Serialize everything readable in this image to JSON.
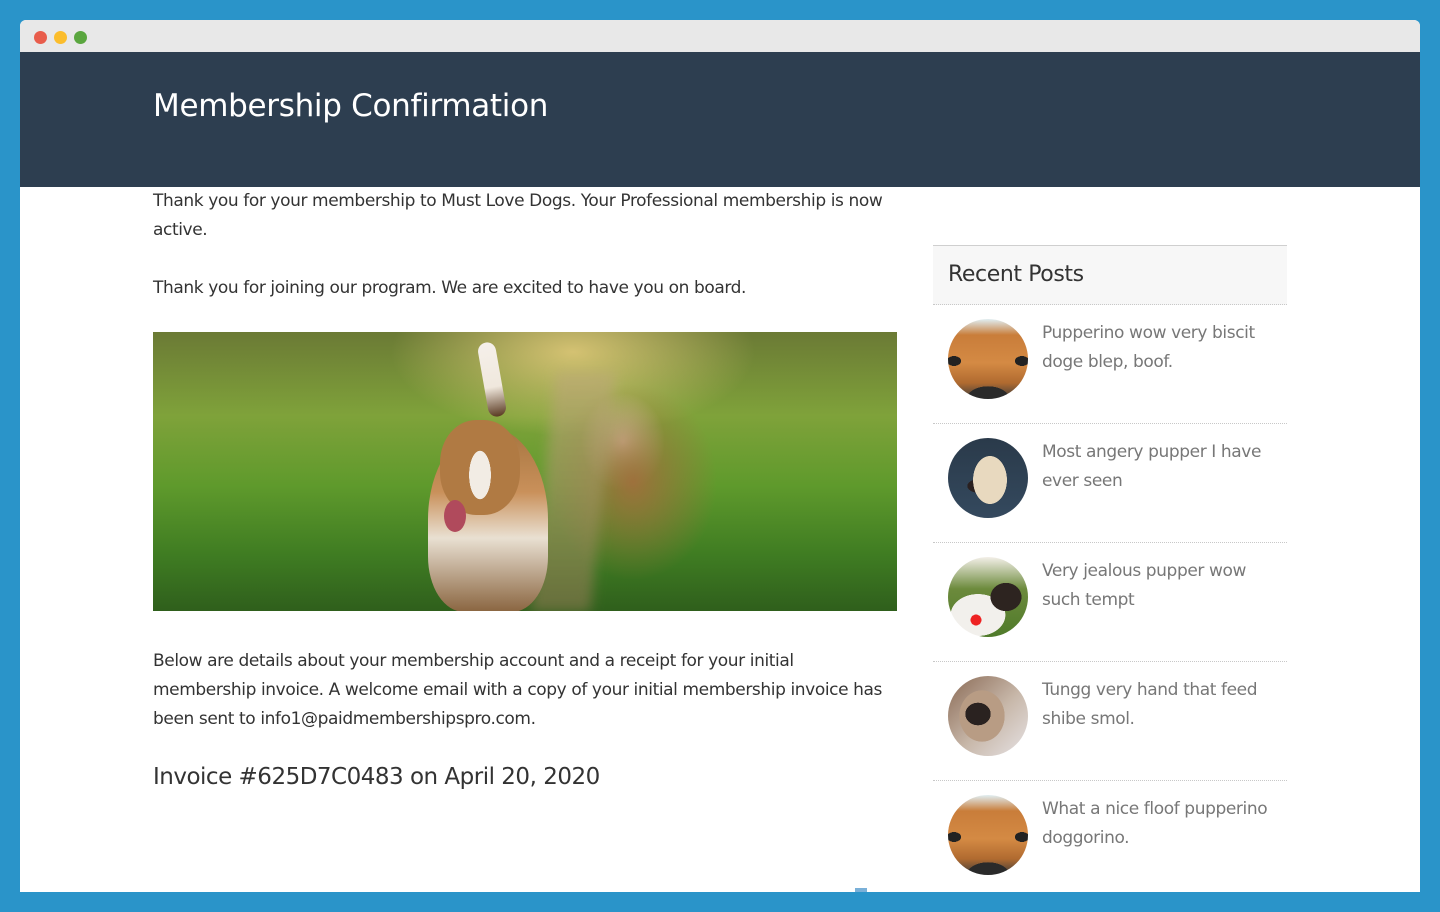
{
  "window": {
    "controls": [
      "close",
      "minimize",
      "maximize"
    ],
    "colors": {
      "close": "#e85d4c",
      "minimize": "#fbbd2c",
      "maximize": "#5aa63f",
      "background": "#2a94c9",
      "hero": "#2d3e50"
    }
  },
  "header": {
    "title": "Membership Confirmation"
  },
  "main": {
    "paragraph1": "Thank you for your membership to Must Love Dogs. Your Professional membership is now active.",
    "paragraph2": "Thank you for joining our program. We are excited to have you on board.",
    "image_alt": "beagle-running-on-grass-path",
    "paragraph3": "Below are details about your membership account and a receipt for your initial membership invoice. A welcome email with a copy of your initial membership invoice has been sent to info1@paidmembershipspro.com.",
    "invoice_heading": "Invoice #625D7C0483 on April 20, 2020"
  },
  "sidebar": {
    "heading": "Recent Posts",
    "posts": [
      {
        "title": "Pupperino wow very biscit doge blep, boof.",
        "thumb": "dog-closeup-face"
      },
      {
        "title": "Most angery pupper I have ever seen",
        "thumb": "labrador"
      },
      {
        "title": "Very jealous pupper wow such tempt",
        "thumb": "puppy-in-mug"
      },
      {
        "title": "Tungg very hand that feed shibe smol.",
        "thumb": "pug-in-blanket"
      },
      {
        "title": "What a nice floof pupperino doggorino.",
        "thumb": "dog-closeup-face"
      }
    ]
  }
}
